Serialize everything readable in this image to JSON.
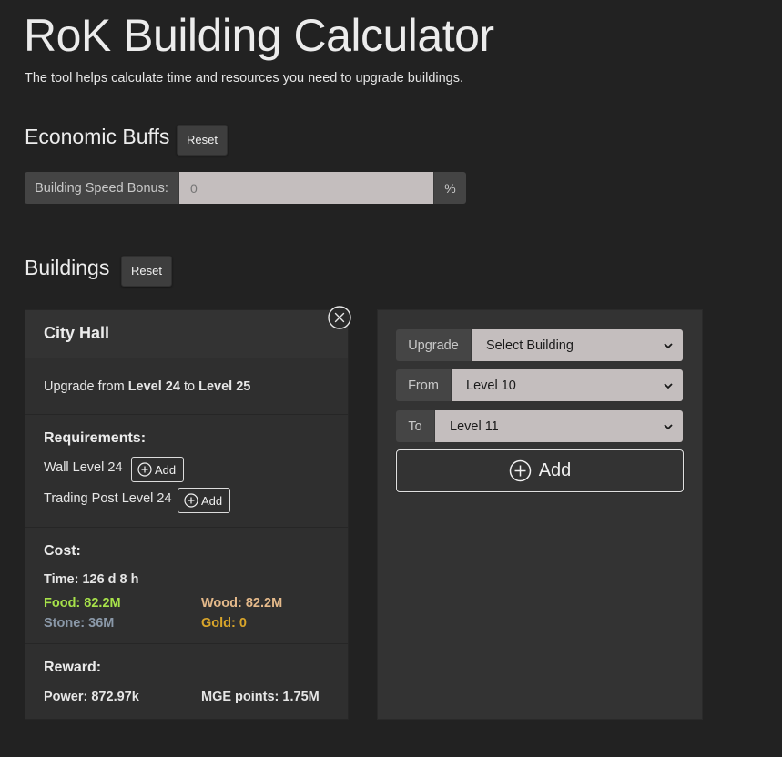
{
  "header": {
    "title": "RoK Building Calculator",
    "subtitle": "The tool helps calculate time and resources you need to upgrade buildings."
  },
  "economic_buffs": {
    "heading": "Economic Buffs",
    "reset_label": "Reset",
    "speed_label": "Building Speed Bonus:",
    "speed_placeholder": "0",
    "speed_unit": "%"
  },
  "buildings": {
    "heading": "Buildings",
    "reset_label": "Reset"
  },
  "card": {
    "title": "City Hall",
    "upgrade_prefix": "Upgrade from",
    "from_level": "Level 24",
    "to_word": "to",
    "to_level": "Level 25",
    "requirements_title": "Requirements:",
    "requirements": [
      {
        "label": "Wall Level 24",
        "add_label": "Add"
      },
      {
        "label": "Trading Post Level 24",
        "add_label": "Add"
      }
    ],
    "cost_title": "Cost:",
    "time": "Time: 126 d 8 h",
    "food": "Food: 82.2M",
    "wood": "Wood: 82.2M",
    "stone": "Stone: 36M",
    "gold": "Gold: 0",
    "reward_title": "Reward:",
    "power": "Power: 872.97k",
    "mge": "MGE points: 1.75M"
  },
  "panel": {
    "upgrade_label": "Upgrade",
    "upgrade_value": "Select Building",
    "from_label": "From",
    "from_value": "Level 10",
    "to_label": "To",
    "to_value": "Level 11",
    "add_label": "Add"
  },
  "colors": {
    "background": "#222222",
    "food": "#a7e24a",
    "wood": "#e4b98a",
    "stone": "#8a98a8",
    "gold": "#d9a52a"
  }
}
